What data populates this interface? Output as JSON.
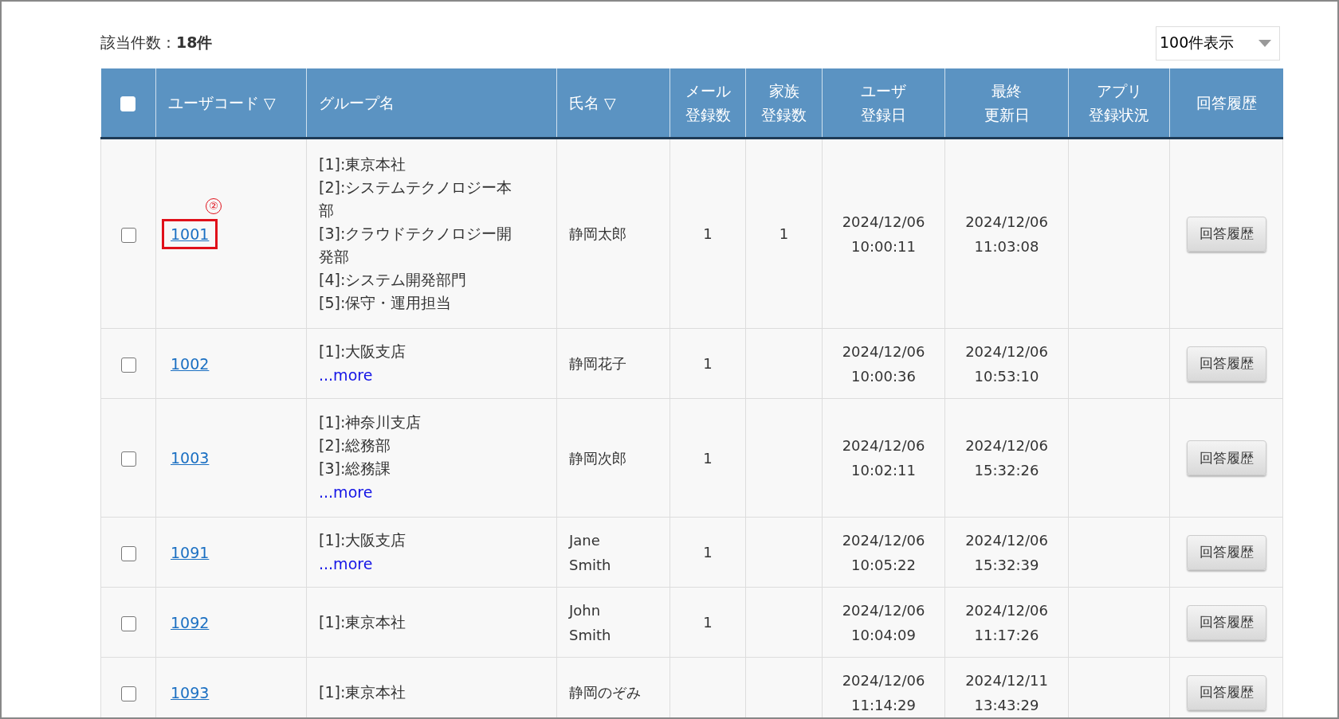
{
  "result_count": {
    "label": "該当件数：",
    "value": "18件"
  },
  "page_size": {
    "value": "100件表示"
  },
  "table": {
    "select_all": {
      "checked": false
    },
    "columns": [
      {
        "lines": [
          "ユーザコード"
        ],
        "sort": "▽"
      },
      {
        "lines": [
          "グループ名"
        ]
      },
      {
        "lines": [
          "氏名"
        ],
        "sort": "▽"
      },
      {
        "lines": [
          "メール",
          "登録数"
        ]
      },
      {
        "lines": [
          "家族",
          "登録数"
        ]
      },
      {
        "lines": [
          "ユーザ",
          "登録日"
        ]
      },
      {
        "lines": [
          "最終",
          "更新日"
        ]
      },
      {
        "lines": [
          "アプリ",
          "登録状況"
        ]
      },
      {
        "lines": [
          "回答履歴"
        ]
      }
    ],
    "rows": [
      {
        "checked": false,
        "code": "1001",
        "annotation": "②",
        "groups": [
          "[1]:東京本社",
          "[2]:システムテクノロジー本部",
          "[3]:クラウドテクノロジー開発部",
          "[4]:システム開発部門",
          "[5]:保守・運用担当"
        ],
        "name": "静岡太郎",
        "mail": "1",
        "family": "1",
        "registered": [
          "2024/12/06",
          "10:00:11"
        ],
        "updated": [
          "2024/12/06",
          "11:03:08"
        ],
        "button": "回答履歴"
      },
      {
        "checked": false,
        "code": "1002",
        "groups": [
          "[1]:大阪支店"
        ],
        "more": "...more",
        "name": "静岡花子",
        "mail": "1",
        "registered": [
          "2024/12/06",
          "10:00:36"
        ],
        "updated": [
          "2024/12/06",
          "10:53:10"
        ],
        "button": "回答履歴"
      },
      {
        "checked": false,
        "code": "1003",
        "groups": [
          "[1]:神奈川支店",
          "[2]:総務部",
          "[3]:総務課"
        ],
        "more": "...more",
        "name": "静岡次郎",
        "mail": "1",
        "registered": [
          "2024/12/06",
          "10:02:11"
        ],
        "updated": [
          "2024/12/06",
          "15:32:26"
        ],
        "button": "回答履歴"
      },
      {
        "checked": false,
        "code": "1091",
        "groups": [
          "[1]:大阪支店"
        ],
        "more": "...more",
        "name": "Jane Smith",
        "mail": "1",
        "registered": [
          "2024/12/06",
          "10:05:22"
        ],
        "updated": [
          "2024/12/06",
          "15:32:39"
        ],
        "button": "回答履歴"
      },
      {
        "checked": false,
        "code": "1092",
        "groups": [
          "[1]:東京本社"
        ],
        "name": "John Smith",
        "mail": "1",
        "registered": [
          "2024/12/06",
          "10:04:09"
        ],
        "updated": [
          "2024/12/06",
          "11:17:26"
        ],
        "button": "回答履歴"
      },
      {
        "checked": false,
        "code": "1093",
        "groups": [
          "[1]:東京本社"
        ],
        "name": "静岡のぞみ",
        "registered": [
          "2024/12/06",
          "11:14:29"
        ],
        "updated": [
          "2024/12/11",
          "13:43:29"
        ],
        "button": "回答履歴"
      }
    ]
  }
}
